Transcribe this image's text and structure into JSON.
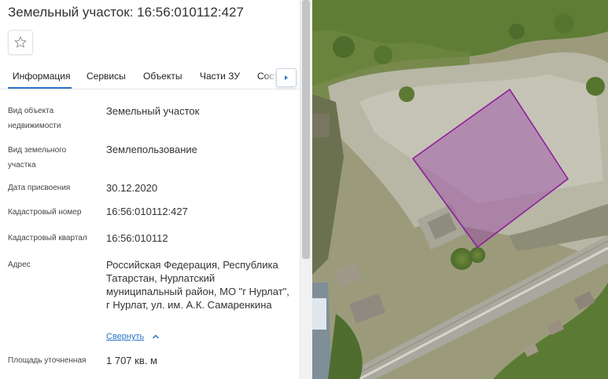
{
  "header": {
    "title": "Земельный участок: 16:56:010112:427"
  },
  "tabs": [
    {
      "label": "Информация",
      "active": true
    },
    {
      "label": "Сервисы",
      "active": false
    },
    {
      "label": "Объекты",
      "active": false
    },
    {
      "label": "Части ЗУ",
      "active": false
    },
    {
      "label": "Сост",
      "active": false
    }
  ],
  "info": {
    "object_type_label": "Вид объекта недвижимости",
    "object_type_value": "Земельный участок",
    "land_type_label": "Вид земельного участка",
    "land_type_value": "Землепользование",
    "assign_date_label": "Дата присвоения",
    "assign_date_value": "30.12.2020",
    "cadastral_number_label": "Кадастровый номер",
    "cadastral_number_value": "16:56:010112:427",
    "cadastral_quarter_label": "Кадастровый квартал",
    "cadastral_quarter_value": "16:56:010112",
    "address_label": "Адрес",
    "address_value": "Российская Федерация, Республика Татарстан, Нурлатский муниципальный район, МО \"г Нурлат\", г Нурлат, ул. им. А.К. Самаренкина",
    "collapse_label": "Свернуть",
    "area_label": "Площадь уточненная",
    "area_value": "1 707 кв. м"
  },
  "colors": {
    "accent": "#2a74c7",
    "parcel_stroke": "#8e1f9a",
    "parcel_fill": "rgba(150,60,170,0.42)"
  },
  "icons": {
    "favorite": "star-icon",
    "tab_next": "chevron-right-icon",
    "collapse": "chevron-up-icon"
  }
}
